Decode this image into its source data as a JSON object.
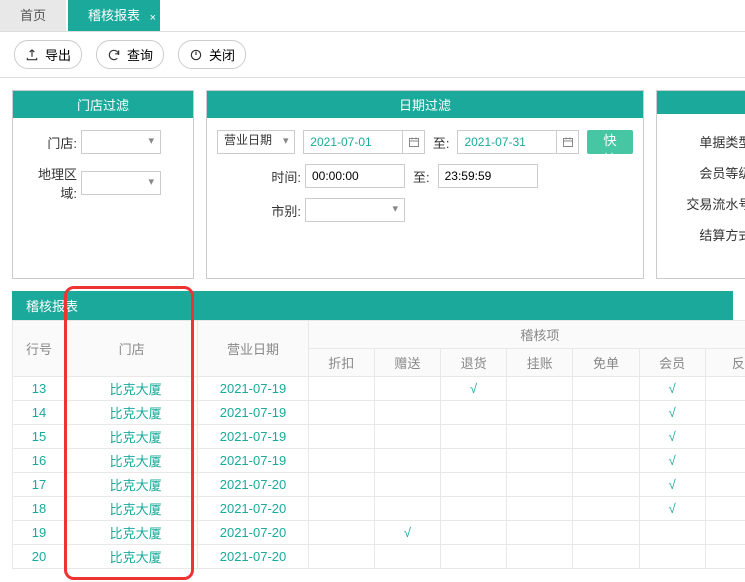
{
  "tabs": {
    "home": "首页",
    "report": "稽核报表"
  },
  "toolbar": {
    "export": "导出",
    "query": "查询",
    "close": "关闭"
  },
  "filter_store": {
    "title": "门店过滤",
    "store_label": "门店:",
    "region_label": "地理区域:"
  },
  "filter_date": {
    "title": "日期过滤",
    "bizdate_label": "营业日期",
    "from": "2021-07-01",
    "to_label": "至:",
    "to": "2021-07-31",
    "fast": "快捷",
    "time_label": "时间:",
    "time_from": "00:00:00",
    "time_to": "23:59:59",
    "shift_label": "市别:"
  },
  "filter_right": {
    "bill_type": "单据类型:",
    "member_level": "会员等级:",
    "trade_no": "交易流水号:",
    "settle": "结算方式:"
  },
  "table": {
    "title": "稽核报表",
    "head_row": "行号",
    "head_store": "门店",
    "head_date": "营业日期",
    "head_group": "稽核项",
    "sub": [
      "折扣",
      "赠送",
      "退货",
      "挂账",
      "免单",
      "会员",
      "反"
    ],
    "rows": [
      {
        "n": "13",
        "s": "比克大厦",
        "d": "2021-07-19",
        "c": [
          "",
          "",
          "√",
          "",
          "",
          "√",
          ""
        ]
      },
      {
        "n": "14",
        "s": "比克大厦",
        "d": "2021-07-19",
        "c": [
          "",
          "",
          "",
          "",
          "",
          "√",
          ""
        ]
      },
      {
        "n": "15",
        "s": "比克大厦",
        "d": "2021-07-19",
        "c": [
          "",
          "",
          "",
          "",
          "",
          "√",
          ""
        ]
      },
      {
        "n": "16",
        "s": "比克大厦",
        "d": "2021-07-19",
        "c": [
          "",
          "",
          "",
          "",
          "",
          "√",
          ""
        ]
      },
      {
        "n": "17",
        "s": "比克大厦",
        "d": "2021-07-20",
        "c": [
          "",
          "",
          "",
          "",
          "",
          "√",
          ""
        ]
      },
      {
        "n": "18",
        "s": "比克大厦",
        "d": "2021-07-20",
        "c": [
          "",
          "",
          "",
          "",
          "",
          "√",
          ""
        ]
      },
      {
        "n": "19",
        "s": "比克大厦",
        "d": "2021-07-20",
        "c": [
          "",
          "√",
          "",
          "",
          "",
          "",
          ""
        ]
      },
      {
        "n": "20",
        "s": "比克大厦",
        "d": "2021-07-20",
        "c": [
          "",
          "",
          "",
          "",
          "",
          "",
          ""
        ]
      }
    ]
  }
}
